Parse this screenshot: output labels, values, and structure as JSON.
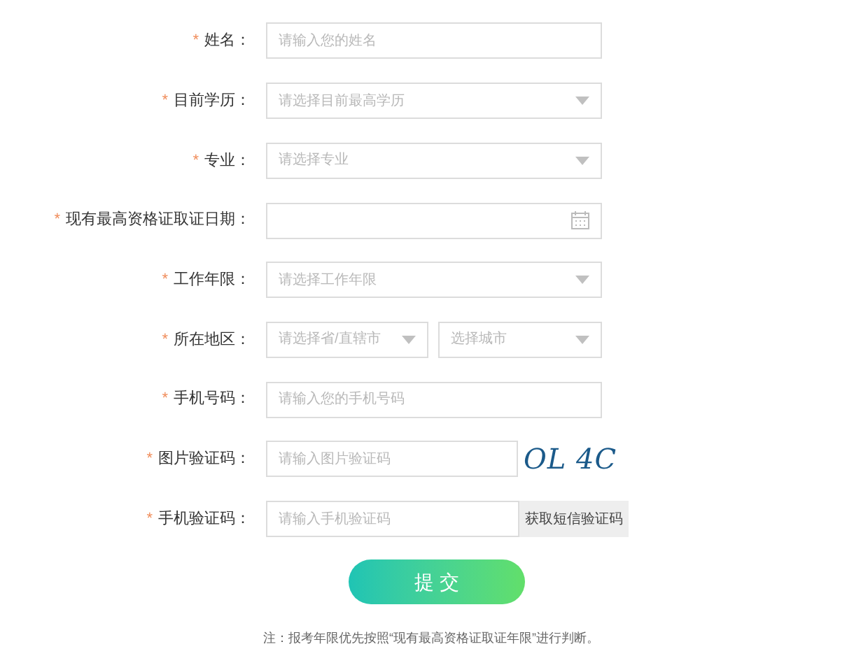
{
  "fields": [
    {
      "kind": "input",
      "mark": "*",
      "label": "姓名：",
      "placeholder": "请输入您的姓名"
    },
    {
      "kind": "select",
      "mark": "*",
      "label": "目前学历：",
      "placeholder": "请选择目前最高学历"
    },
    {
      "kind": "select",
      "mark": "*",
      "label": "专业：",
      "placeholder": "请选择专业"
    },
    {
      "kind": "date",
      "mark": "*",
      "label": "现有最高资格证取证日期："
    },
    {
      "kind": "select",
      "mark": "*",
      "label": "工作年限：",
      "placeholder": "请选择工作年限"
    },
    {
      "kind": "region",
      "mark": "*",
      "label": "所在地区：",
      "placeholders": [
        "请选择省/直辖市",
        "选择城市"
      ]
    },
    {
      "kind": "input",
      "mark": "*",
      "label": "手机号码：",
      "placeholder": "请输入您的手机号码"
    },
    {
      "kind": "captcha",
      "mark": "*",
      "label": "图片验证码：",
      "placeholder": "请输入图片验证码",
      "captcha": "OL 4C"
    },
    {
      "kind": "sms",
      "mark": "*",
      "label": "手机验证码：",
      "placeholder": "请输入手机验证码",
      "button": "获取短信验证码"
    }
  ],
  "submit": "提 交",
  "note": "注：报考年限优先按照“现有最高资格证取证年限”进行判断。"
}
